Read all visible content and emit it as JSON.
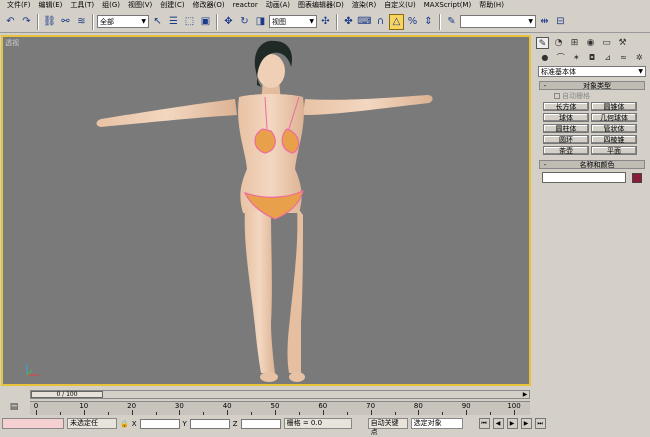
{
  "menu": [
    "文件(F)",
    "编辑(E)",
    "工具(T)",
    "组(G)",
    "视图(V)",
    "创建(C)",
    "修改器(O)",
    "reactor",
    "动画(A)",
    "图表编辑器(D)",
    "渲染(R)",
    "自定义(U)",
    "MAXScript(M)",
    "帮助(H)"
  ],
  "toolbar": {
    "filter_value": "全部",
    "coord_value": "视图"
  },
  "viewport": {
    "label": "透视",
    "accent": "#e8c238",
    "bg": "#7a7a7a"
  },
  "command_panel": {
    "category_value": "标准基本体",
    "object_type_title": "对象类型",
    "autogrid_label": "自动栅格",
    "buttons": [
      "长方体",
      "圆锥体",
      "球体",
      "几何球体",
      "圆柱体",
      "管状体",
      "圆环",
      "四棱锥",
      "茶壶",
      "平面"
    ],
    "name_color_title": "名称和颜色",
    "swatch_color": "#8b1a3a"
  },
  "timeline": {
    "slider_text": "0 / 100",
    "ticks": [
      "0",
      "10",
      "20",
      "30",
      "40",
      "50",
      "60",
      "70",
      "80",
      "90",
      "100"
    ],
    "tick_values": [
      0,
      10,
      20,
      30,
      40,
      50,
      60,
      70,
      80,
      90,
      100
    ]
  },
  "status": {
    "selection": "未选定任",
    "x_label": "X",
    "y_label": "Y",
    "z_label": "Z",
    "grid_text": "栅格 = 0.0",
    "autokey": "自动关键点",
    "selected_obj": "选定对象"
  }
}
